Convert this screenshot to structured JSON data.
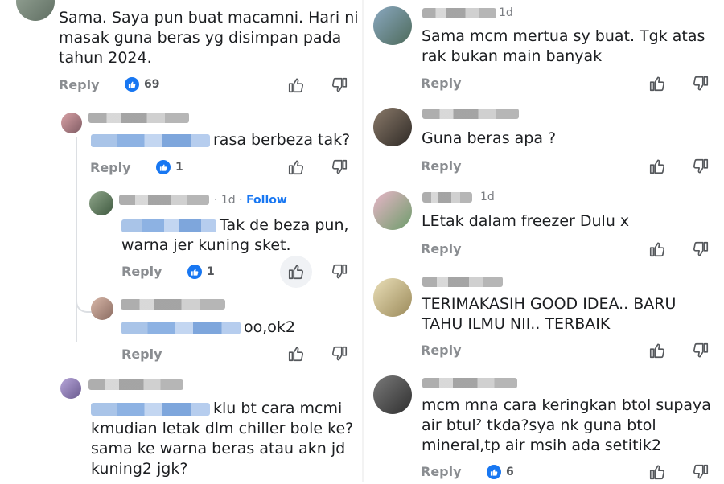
{
  "left": {
    "c1": {
      "text_lines": [
        "Sama. Saya pun buat macamni. Hari ni",
        "masak guna beras yg disimpan pada",
        "tahun 2024."
      ],
      "reply": "Reply",
      "likes": "69"
    },
    "c2": {
      "text_lines": [
        "rasa berbeza tak?"
      ],
      "reply": "Reply",
      "likes": "1"
    },
    "c3": {
      "time": "· 1d ·",
      "follow": "Follow",
      "text_lines": [
        "Tak de beza pun,",
        "warna jer kuning sket."
      ],
      "reply": "Reply",
      "likes": "1"
    },
    "c4": {
      "text_lines": [
        "oo,ok2"
      ],
      "reply": "Reply"
    },
    "c5": {
      "text_lines": [
        "klu bt cara mcmi",
        "kmudian letak dlm chiller bole ke?",
        "sama ke warna beras atau akn jd",
        "kuning2 jgk?"
      ]
    }
  },
  "right": {
    "c1": {
      "time": "1d",
      "text_lines": [
        "Sama mcm mertua sy buat. Tgk atas",
        "rak bukan main banyak"
      ],
      "reply": "Reply"
    },
    "c2": {
      "text_lines": [
        "Guna beras apa ?"
      ],
      "reply": "Reply"
    },
    "c3": {
      "time": "1d",
      "text_lines": [
        "LEtak dalam freezer Dulu x"
      ],
      "reply": "Reply"
    },
    "c4": {
      "text_lines": [
        "TERIMAKASIH GOOD IDEA.. BARU",
        "TAHU ILMU NII.. TERBAIK"
      ],
      "reply": "Reply"
    },
    "c5": {
      "text_lines": [
        "mcm mna cara keringkan btol supaya",
        "air btul² tkda?sya nk guna btol",
        "mineral,tp air msih ada setitik2"
      ],
      "reply": "Reply",
      "likes": "6"
    }
  },
  "icons": {
    "like": "thumbs-up-icon",
    "dislike": "thumbs-down-icon",
    "reaction": "like-reaction-icon"
  },
  "colors": {
    "accent": "#1877f2",
    "muted": "#8a8d91"
  }
}
